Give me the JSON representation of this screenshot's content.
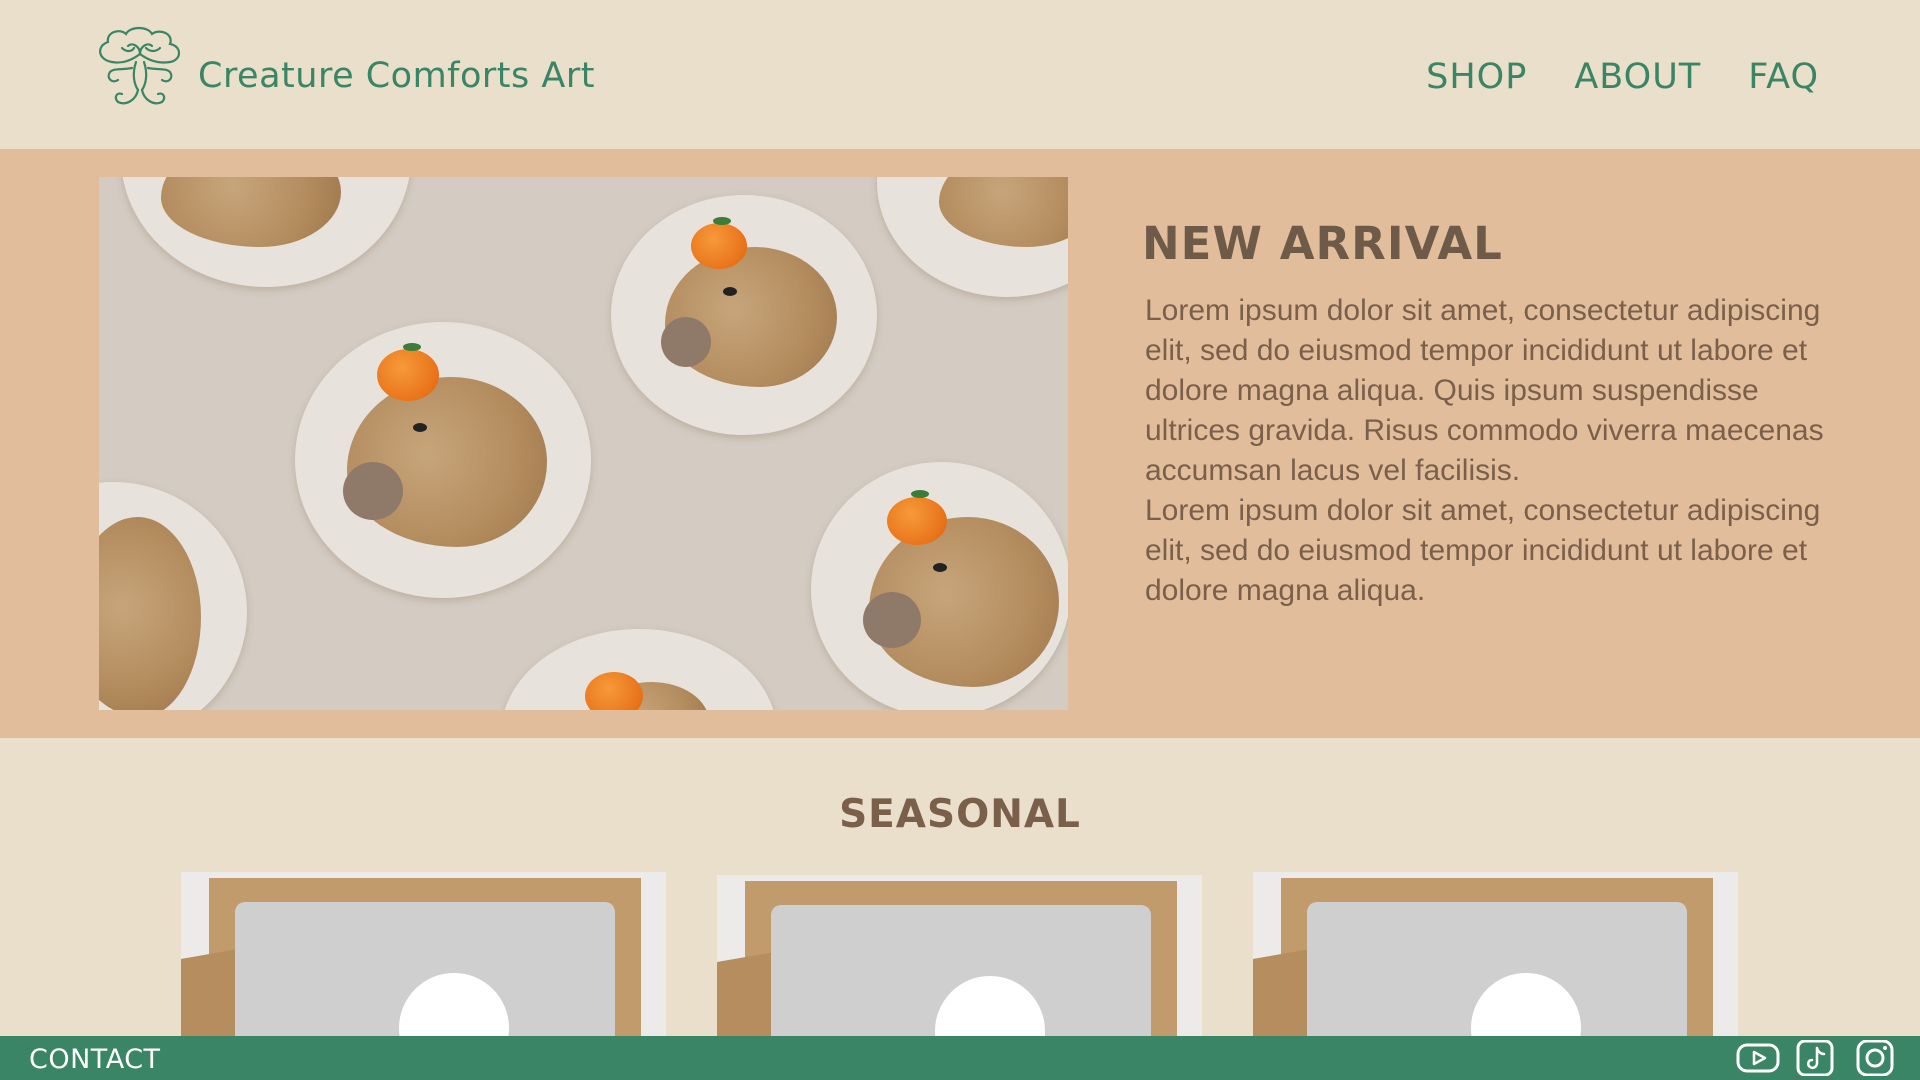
{
  "header": {
    "brand": "Creature Comforts Art",
    "logo_icon": "tree-logo-icon",
    "nav": [
      {
        "label": "SHOP"
      },
      {
        "label": "ABOUT"
      },
      {
        "label": "FAQ"
      }
    ]
  },
  "hero": {
    "title": "NEW ARRIVAL",
    "paragraphs": [
      "Lorem ipsum dolor sit amet, consectetur adipiscing elit, sed do eiusmod tempor incididunt ut labore et dolore magna aliqua. Quis ipsum suspendisse ultrices gravida. Risus commodo viverra maecenas accumsan lacus vel facilisis.",
      "Lorem ipsum dolor sit amet, consectetur adipiscing elit, sed do eiusmod tempor incididunt ut labore et dolore magna aliqua."
    ],
    "image_subject": "capybara-with-orange-stickers"
  },
  "seasonal": {
    "title": "SEASONAL",
    "cards": [
      {
        "image_subject": "gift-box-with-sticker"
      },
      {
        "image_subject": "gift-box-with-sticker"
      },
      {
        "image_subject": "gift-box-with-sticker"
      }
    ]
  },
  "footer": {
    "contact": "CONTACT",
    "social_icons": [
      "youtube-icon",
      "tiktok-icon",
      "instagram-icon"
    ]
  },
  "colors": {
    "background": "#e9dfcb",
    "hero_band": "#e2bd9c",
    "brand_green": "#3a8565",
    "text_brown": "#7a604b"
  }
}
